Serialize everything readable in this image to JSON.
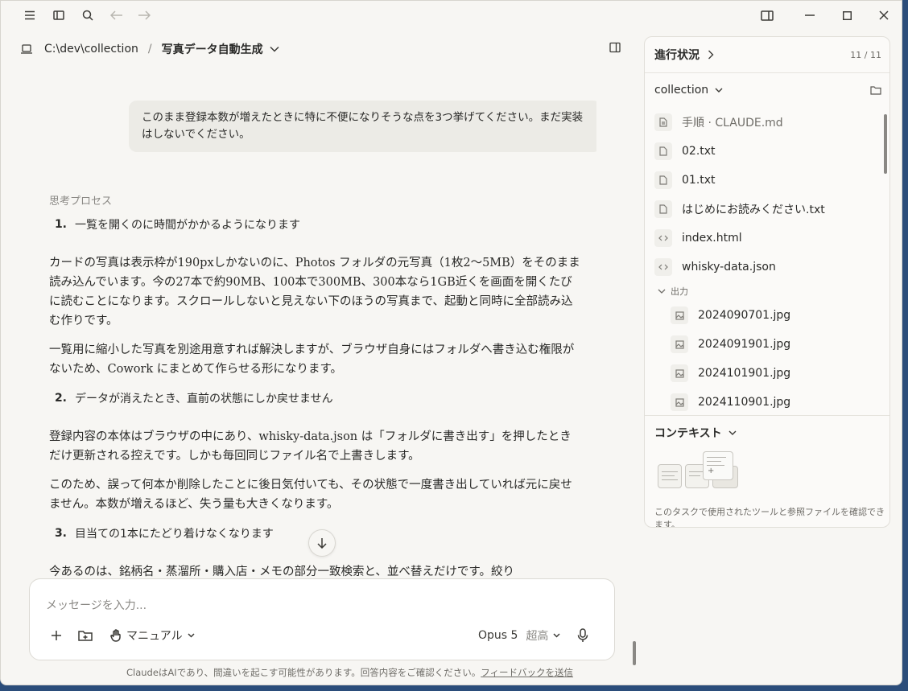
{
  "breadcrumb": {
    "path": "C:\\dev\\collection",
    "separator": "/",
    "project": "写真データ自動生成"
  },
  "chat": {
    "user_message": "このまま登録本数が増えたときに特に不便になりそうな点を3つ挙げてください。まだ実装はしないでください。",
    "thinking_label": "思考プロセス",
    "items": [
      {
        "num": "1.",
        "heading": "一覧を開くのに時間がかかるようになります",
        "paragraphs": [
          "カードの写真は表示枠が190pxしかないのに、Photos フォルダの元写真（1枚2〜5MB）をそのまま読み込んでいます。今の27本で約90MB、100本で300MB、300本なら1GB近くを画面を開くたびに読むことになります。スクロールしないと見えない下のほうの写真まで、起動と同時に全部読み込む作りです。",
          "一覧用に縮小した写真を別途用意すれば解決しますが、ブラウザ自身にはフォルダへ書き込む権限がないため、Cowork にまとめて作らせる形になります。"
        ]
      },
      {
        "num": "2.",
        "heading": "データが消えたとき、直前の状態にしか戻せません",
        "paragraphs": [
          "登録内容の本体はブラウザの中にあり、whisky-data.json は「フォルダに書き出す」を押したときだけ更新される控えです。しかも毎回同じファイル名で上書きします。",
          "このため、誤って何本か削除したことに後日気付いても、その状態で一度書き出していれば元に戻せません。本数が増えるほど、失う量も大きくなります。"
        ]
      },
      {
        "num": "3.",
        "heading": "目当ての1本にたどり着けなくなります",
        "paragraphs": [
          "今あるのは、銘柄名・蒸溜所・購入店・メモの部分一致検索と、並べ替えだけです。絞り"
        ]
      }
    ]
  },
  "composer": {
    "placeholder": "メッセージを入力...",
    "mode_label": "マニュアル",
    "model": "Opus 5",
    "effort": "超高"
  },
  "disclaimer": {
    "text": "ClaudeはAIであり、間違いを起こす可能性があります。回答内容をご確認ください。",
    "link": "フィードバックを送信"
  },
  "side": {
    "progress_title": "進行状況",
    "progress_count": "11 / 11",
    "folder_name": "collection",
    "files": [
      {
        "name": "手順 · CLAUDE.md",
        "icon": "doc-icon"
      },
      {
        "name": "02.txt",
        "icon": "file-icon"
      },
      {
        "name": "01.txt",
        "icon": "file-icon"
      },
      {
        "name": "はじめにお読みください.txt",
        "icon": "file-icon"
      },
      {
        "name": "index.html",
        "icon": "code-icon"
      },
      {
        "name": "whisky-data.json",
        "icon": "code-icon"
      }
    ],
    "subfolder": "出力",
    "output_files": [
      "2024090701.jpg",
      "2024091901.jpg",
      "2024101901.jpg",
      "2024110901.jpg"
    ],
    "context_title": "コンテキスト",
    "context_desc": "このタスクで使用されたツールと参照ファイルを確認できます。"
  }
}
